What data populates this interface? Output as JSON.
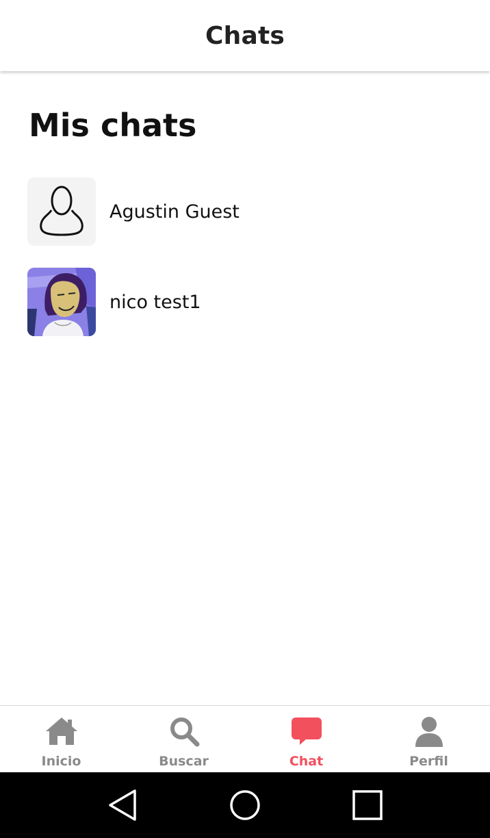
{
  "header": {
    "title": "Chats"
  },
  "section": {
    "title": "Mis chats"
  },
  "chats": [
    {
      "name": "Agustin Guest",
      "avatar": "default-user-icon"
    },
    {
      "name": "nico test1",
      "avatar": "profile-photo"
    }
  ],
  "tabs": [
    {
      "label": "Inicio",
      "icon": "home-icon",
      "active": false
    },
    {
      "label": "Buscar",
      "icon": "search-icon",
      "active": false
    },
    {
      "label": "Chat",
      "icon": "chat-bubble-icon",
      "active": true
    },
    {
      "label": "Perfil",
      "icon": "person-icon",
      "active": false
    }
  ],
  "colors": {
    "accent": "#f2505d",
    "tab_inactive": "#8a8a8a",
    "system_nav_bg": "#000000"
  },
  "system_nav": {
    "buttons": [
      "back-icon",
      "home-circle-icon",
      "recents-icon"
    ]
  }
}
